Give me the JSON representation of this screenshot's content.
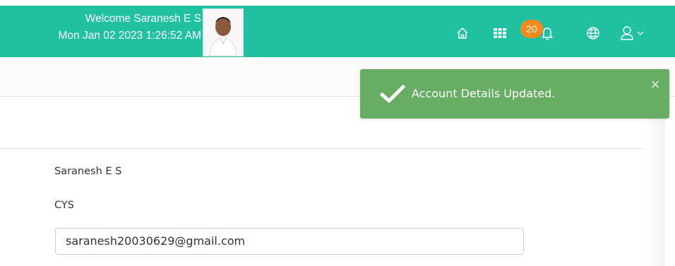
{
  "header": {
    "welcome_text": "Welcome Saranesh E S",
    "datetime": "Mon Jan 02 2023 1:26:52 AM",
    "notification_count": "20",
    "icons": [
      "home-icon",
      "apps-grid-icon",
      "bell-icon",
      "globe-icon",
      "user-icon",
      "chevron-down-icon"
    ]
  },
  "toast": {
    "message": "Account Details Updated.",
    "close_symbol": "×"
  },
  "profile": {
    "name": "Saranesh E S",
    "department": "CYS",
    "email": "saranesh20030629@gmail.com"
  },
  "colors": {
    "header_bg": "#1fc1a0",
    "toast_bg": "#68ad64",
    "badge_bg": "#f58a1f"
  }
}
